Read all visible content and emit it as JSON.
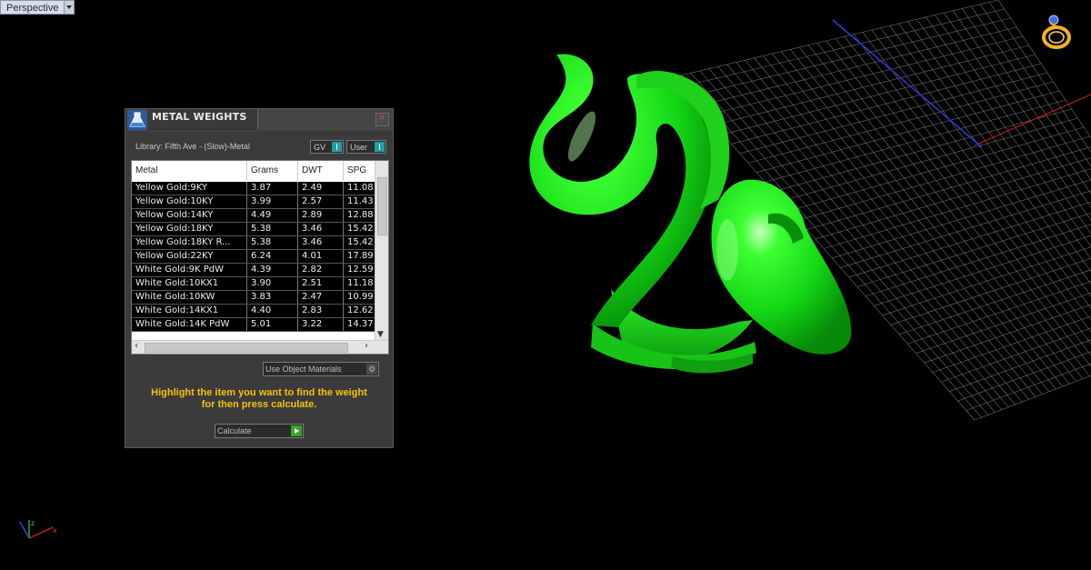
{
  "viewport": {
    "label": "Perspective"
  },
  "panel": {
    "title": "METAL WEIGHTS",
    "library": "Library: Fifth Ave - (Slow)-Metal",
    "toggles": {
      "gv": "GV",
      "user": "User"
    },
    "columns": [
      "Metal",
      "Grams",
      "DWT",
      "SPG"
    ],
    "rows": [
      [
        "Yellow Gold:9KY",
        "3.87",
        "2.49",
        "11.08"
      ],
      [
        "Yellow Gold:10KY",
        "3.99",
        "2.57",
        "11.43"
      ],
      [
        "Yellow Gold:14KY",
        "4.49",
        "2.89",
        "12.88"
      ],
      [
        "Yellow Gold:18KY",
        "5.38",
        "3.46",
        "15.42"
      ],
      [
        "Yellow Gold:18KY R...",
        "5.38",
        "3.46",
        "15.42"
      ],
      [
        "Yellow Gold:22KY",
        "6.24",
        "4.01",
        "17.89"
      ],
      [
        "White Gold:9K PdW",
        "4.39",
        "2.82",
        "12.59"
      ],
      [
        "White Gold:10KX1",
        "3.90",
        "2.51",
        "11.18"
      ],
      [
        "White Gold:10KW",
        "3.83",
        "2.47",
        "10.99"
      ],
      [
        "White Gold:14KX1",
        "4.40",
        "2.83",
        "12.62"
      ],
      [
        "White Gold:14K PdW",
        "5.01",
        "3.22",
        "14.37"
      ]
    ],
    "materials_option": "Use Object Materials",
    "instruction_line1": "Highlight the item you want to find the weight",
    "instruction_line2": "for then press calculate.",
    "calculate_label": "Calculate"
  },
  "icons": {
    "app": "flask-icon",
    "close": "close-icon",
    "scene_tool": "ring-icon",
    "axes": "axis-gizmo-icon"
  },
  "colors": {
    "model": "#19e01a",
    "accent_text": "#f5c20a",
    "toggle": "#1fa0a6"
  }
}
